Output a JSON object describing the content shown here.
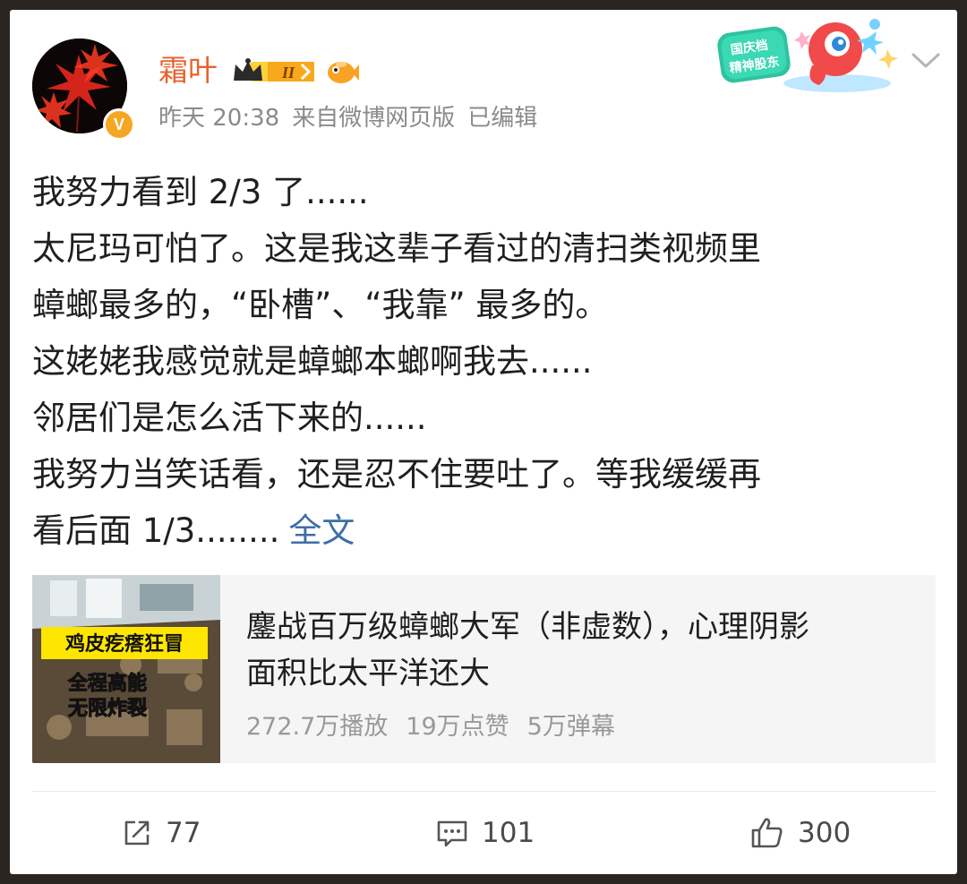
{
  "post": {
    "username": "霜叶",
    "level": "II",
    "timestamp": "昨天 20:38",
    "source": "来自微博网页版",
    "edited": "已编辑",
    "festival_badge": "国庆档 精神股东",
    "body_lines": [
      "我努力看到 2/3 了......",
      "太尼玛可怕了。这是我这辈子看过的清扫类视频里",
      "蟑螂最多的，“卧槽”、“我靠” 最多的。",
      "这姥姥我感觉就是蟑螂本螂啊我去......",
      "邻居们是怎么活下来的......",
      "我努力当笑话看，还是忍不住要吐了。等我缓缓再",
      "看后面 1/3........"
    ],
    "full_text_link": "全文"
  },
  "video": {
    "thumbnail_caption_1": "鸡皮疙瘩狂冒",
    "thumbnail_caption_2": "全程高能",
    "thumbnail_caption_3": "无限炸裂",
    "title_lines": [
      "鏖战百万级蟑螂大军（非虚数），心理阴影",
      "面积比太平洋还大"
    ],
    "plays": "272.7万播放",
    "likes": "19万点赞",
    "danmaku": "5万弹幕"
  },
  "actions": {
    "repost_count": "77",
    "comment_count": "101",
    "like_count": "300"
  },
  "colors": {
    "username": "#e8612c",
    "link": "#3d6ea8",
    "meta": "#8a8a8a",
    "verify_badge": "#f5a623"
  },
  "icons": {
    "repost": "share-icon",
    "comment": "comment-icon",
    "like": "thumbs-up-icon",
    "more": "chevron-down-icon"
  }
}
